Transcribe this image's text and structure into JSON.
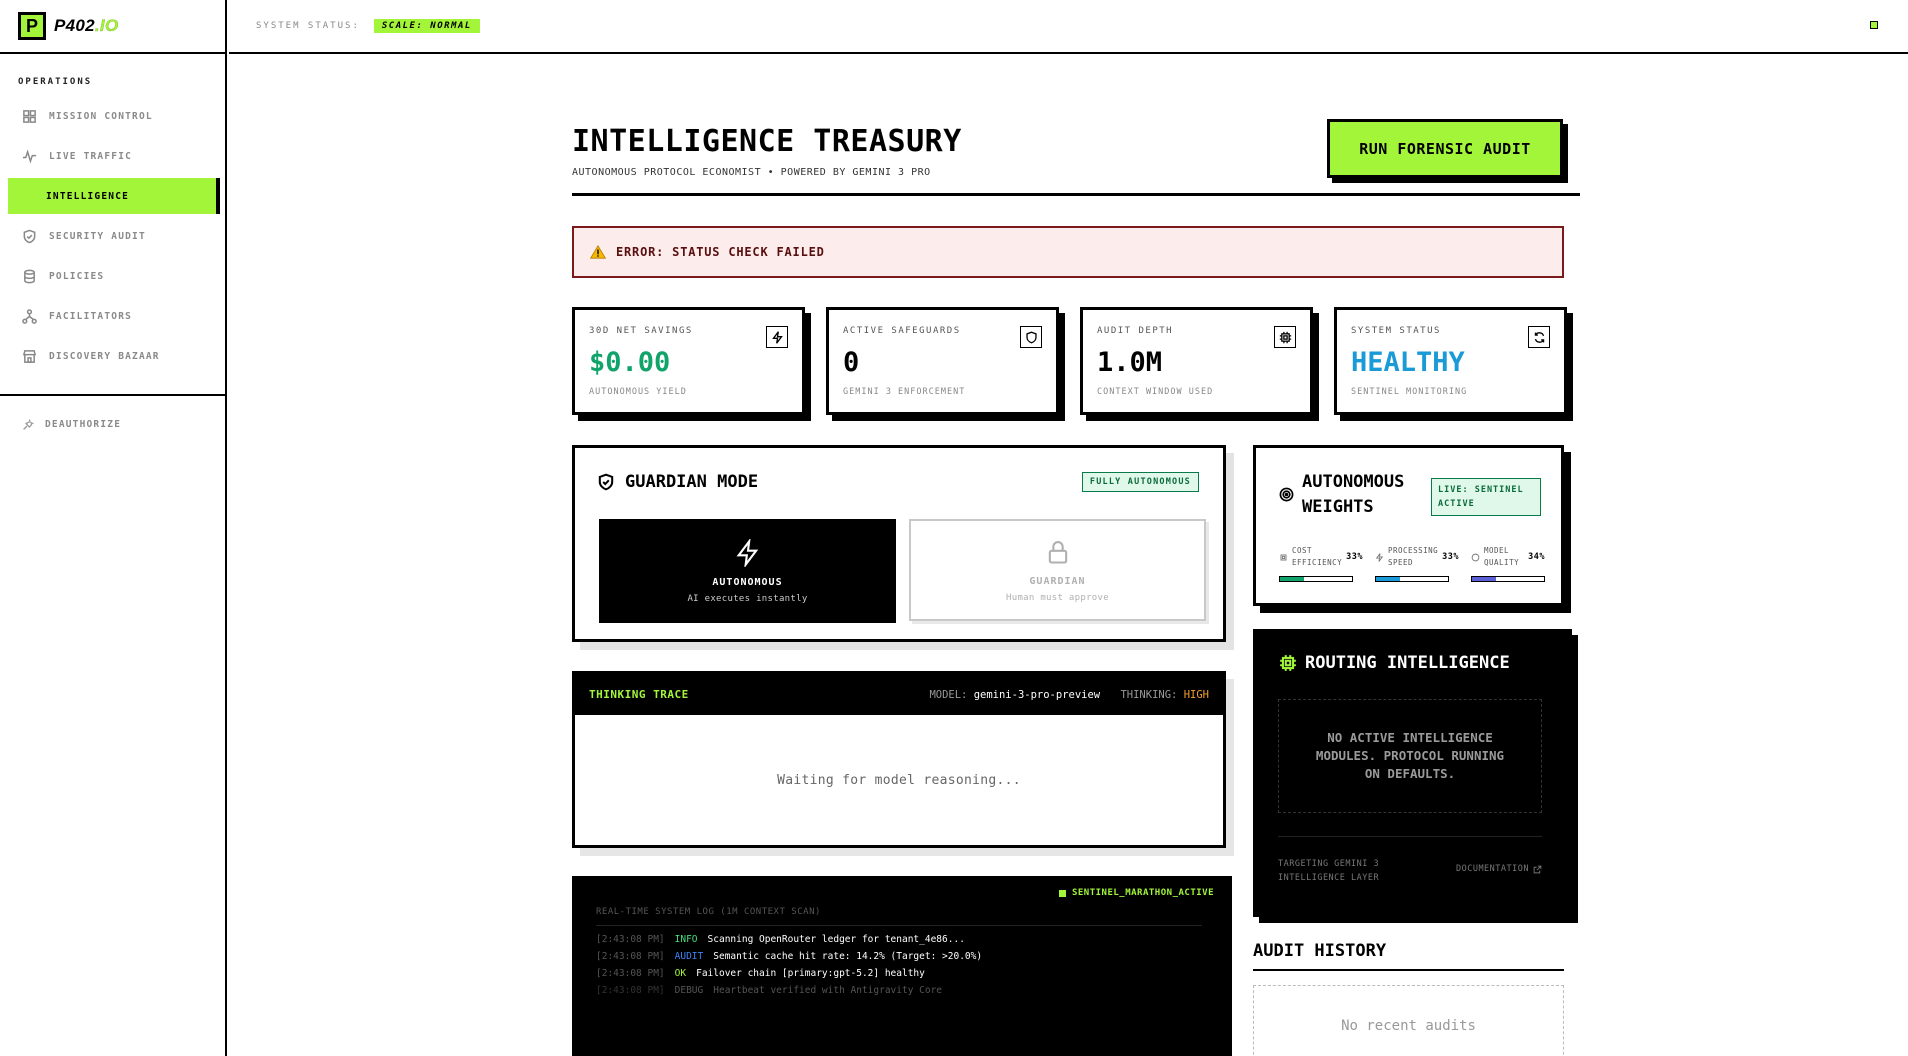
{
  "brand": {
    "logo_letter": "P",
    "name_main": "P402",
    "name_suffix": ".IO"
  },
  "topbar": {
    "status_label": "SYSTEM STATUS:",
    "status_badge": "SCALE: NORMAL"
  },
  "sidebar": {
    "section_label": "OPERATIONS",
    "items": [
      {
        "label": "MISSION CONTROL",
        "icon": "grid-icon"
      },
      {
        "label": "LIVE TRAFFIC",
        "icon": "activity-icon"
      },
      {
        "label": "INTELLIGENCE",
        "icon": "",
        "active": true
      },
      {
        "label": "SECURITY AUDIT",
        "icon": "shield-check-icon"
      },
      {
        "label": "POLICIES",
        "icon": "database-icon"
      },
      {
        "label": "FACILITATORS",
        "icon": "network-icon"
      },
      {
        "label": "DISCOVERY BAZAAR",
        "icon": "store-icon"
      }
    ],
    "deauthorize": "DEAUTHORIZE"
  },
  "header": {
    "title": "INTELLIGENCE TREASURY",
    "subtitle": "AUTONOMOUS PROTOCOL ECONOMIST • POWERED BY GEMINI 3 PRO",
    "audit_button": "RUN FORENSIC AUDIT"
  },
  "error": {
    "message": "ERROR: STATUS CHECK FAILED"
  },
  "stats": [
    {
      "label": "30D NET SAVINGS",
      "value": "$0.00",
      "foot": "AUTONOMOUS YIELD",
      "color": "#10a36a",
      "icon": "zap-icon"
    },
    {
      "label": "ACTIVE SAFEGUARDS",
      "value": "0",
      "foot": "GEMINI 3 ENFORCEMENT",
      "color": "#000000",
      "icon": "shield-icon"
    },
    {
      "label": "AUDIT DEPTH",
      "value": "1.0M",
      "foot": "CONTEXT WINDOW USED",
      "color": "#000000",
      "icon": "cpu-icon"
    },
    {
      "label": "SYSTEM STATUS",
      "value": "HEALTHY",
      "foot": "SENTINEL MONITORING",
      "color": "#1a9ad6",
      "icon": "refresh-icon"
    }
  ],
  "guardian": {
    "title": "GUARDIAN MODE",
    "badge": "FULLY AUTONOMOUS",
    "modes": [
      {
        "name": "AUTONOMOUS",
        "desc": "AI executes instantly",
        "selected": true
      },
      {
        "name": "GUARDIAN",
        "desc": "Human must approve",
        "selected": false
      }
    ]
  },
  "trace": {
    "title": "THINKING TRACE",
    "model_label": "MODEL:",
    "model_value": "gemini-3-pro-preview",
    "thinking_label": "THINKING:",
    "thinking_value": "HIGH",
    "placeholder": "Waiting for model reasoning..."
  },
  "syslog": {
    "active": "SENTINEL_MARATHON_ACTIVE",
    "title": "REAL-TIME SYSTEM LOG (1M CONTEXT SCAN)",
    "lines": [
      {
        "ts": "[2:43:08 PM]",
        "level": "INFO",
        "msg": "Scanning OpenRouter ledger for tenant_4e86..."
      },
      {
        "ts": "[2:43:08 PM]",
        "level": "AUDIT",
        "msg": "Semantic cache hit rate: 14.2% (Target: >20.0%)"
      },
      {
        "ts": "[2:43:08 PM]",
        "level": "OK",
        "msg": "Failover chain [primary:gpt-5.2] healthy"
      },
      {
        "ts": "[2:43:08 PM]",
        "level": "DEBUG",
        "msg": "Heartbeat verified with Antigravity Core"
      }
    ]
  },
  "weights": {
    "title_line1": "AUTONOMOUS",
    "title_line2": "WEIGHTS",
    "badge": "LIVE: SENTINEL ACTIVE",
    "metrics": [
      {
        "label": "COST EFFICIENCY",
        "pct_text": "33%",
        "value": 0.33,
        "color": "#10a36a",
        "icon": "cpu-icon"
      },
      {
        "label": "PROCESSING SPEED",
        "pct_text": "33%",
        "value": 0.33,
        "color": "#1a9ad6",
        "icon": "zap-icon"
      },
      {
        "label": "MODEL QUALITY",
        "pct_text": "34%",
        "value": 0.34,
        "color": "#5b5fd6",
        "icon": "circle-icon"
      }
    ]
  },
  "routing": {
    "title": "ROUTING INTELLIGENCE",
    "empty": "NO ACTIVE INTELLIGENCE MODULES. PROTOCOL RUNNING ON DEFAULTS.",
    "foot": "TARGETING GEMINI 3 INTELLIGENCE LAYER",
    "doc_link": "DOCUMENTATION"
  },
  "audit_history": {
    "title": "AUDIT HISTORY",
    "empty": "No recent audits"
  }
}
